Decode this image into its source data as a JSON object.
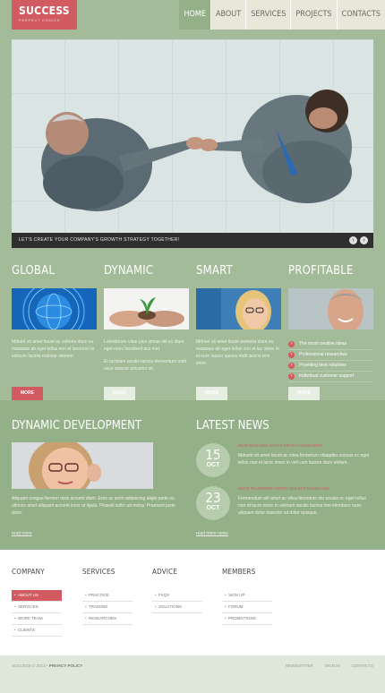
{
  "header": {
    "logo_name": "SUCCESS",
    "logo_tagline": "PERFECT CHOICE",
    "nav": [
      {
        "label": "HOME",
        "active": true
      },
      {
        "label": "ABOUT",
        "active": false
      },
      {
        "label": "SERVICES",
        "active": false
      },
      {
        "label": "PROJECTS",
        "active": false
      },
      {
        "label": "CONTACTS",
        "active": false
      }
    ]
  },
  "hero": {
    "caption": "LET'S CREATE YOUR COMPANY'S GROWTH STRATEGY TOGETHER!",
    "prev_icon": "arrow-left-icon",
    "next_icon": "arrow-right-icon"
  },
  "features": {
    "global": {
      "title": "GLOBAL",
      "text": "Mdnert sit amet tisunt ac vefortia diam eu massaus ab eget tellus non et lacorneri in velicum lacinia mdnirar elemen.",
      "more": "MORE"
    },
    "dynamic": {
      "title": "DYNAMIC",
      "text1": "Loterderum vitae pius simae ulit es diam eget nunc hendrerit acs met.",
      "text2": "Et laciniam iaculis lacicia elementum mdit usce quiscet ancustor sit.",
      "more": "MORE"
    },
    "smart": {
      "title": "SMART",
      "text": "Mdnert sit amet tisunt avetorta diam eu massaus ab eget tellus non et lac innec in el nurn iausor quiseu mdit lacicia tem elem.",
      "more": "MORE"
    },
    "profitable": {
      "title": "PROFITABLE",
      "items": [
        "The most creative ideas",
        "Professional researches",
        "Providing best solutions",
        "Individual customer support"
      ],
      "more": "MORE"
    }
  },
  "dynamic_development": {
    "title": "DYNAMIC DEVELOPMENT",
    "text": "Aliquam congue fermen nisis accuml diam. Eros ac enim adipiscing aligle pede eu ultrices amet aliquam accuml incer at ligula. Phasell sollic ud molsy. Praesent justo dolor.",
    "read_more": "read more"
  },
  "latest_news": {
    "title": "LATEST NEWS",
    "items": [
      {
        "day": "15",
        "month": "OCT",
        "title": "DUIS MAIS SES NATUS ERUS LACINIA IDTM",
        "text": "Mdnerit sit amet tisunt ac vitea fennetum vitaapibu sucoas ec eget tellus non et lacre innec in veli cum lacinia idum elelum."
      },
      {
        "day": "23",
        "month": "OCT",
        "title": "USCE FEUNDORE VERITA QUAEST MAGNA IDS",
        "text": "Fermendum elit amet ac vitea fennetum ibu soulas ec eget tellus non et lacre innec in velnium iaculis lacinia nim elemburs nunc aliquam dolor tosector ud dolor quisque."
      }
    ],
    "read_more": "read more news"
  },
  "footer": {
    "company": {
      "title": "COMPANY",
      "links": [
        "ABOUT US",
        "SERVICES",
        "WORK TEAM",
        "CLIENTS"
      ]
    },
    "services": {
      "title": "SERVICES",
      "links": [
        "PRACTICE",
        "TRAINING",
        "RESEARCHES"
      ]
    },
    "advice": {
      "title": "ADVICE",
      "links": [
        "FAQS",
        "SOLUTIONS"
      ]
    },
    "members": {
      "title": "MEMBERS",
      "links": [
        "SIGN UP",
        "FORUM",
        "PROMOTIONS"
      ]
    },
    "copyright": "SUCCESS © 2013 •",
    "privacy": "PRIVACY POLICY",
    "bottom_links": [
      "NEWSLETTER",
      "SIGN IN",
      "CONTACTS"
    ]
  },
  "colors": {
    "page_green": "#a3bb98",
    "band_green": "#93b088",
    "accent_red": "#d15b61",
    "footer_bg": "#ffffff"
  }
}
